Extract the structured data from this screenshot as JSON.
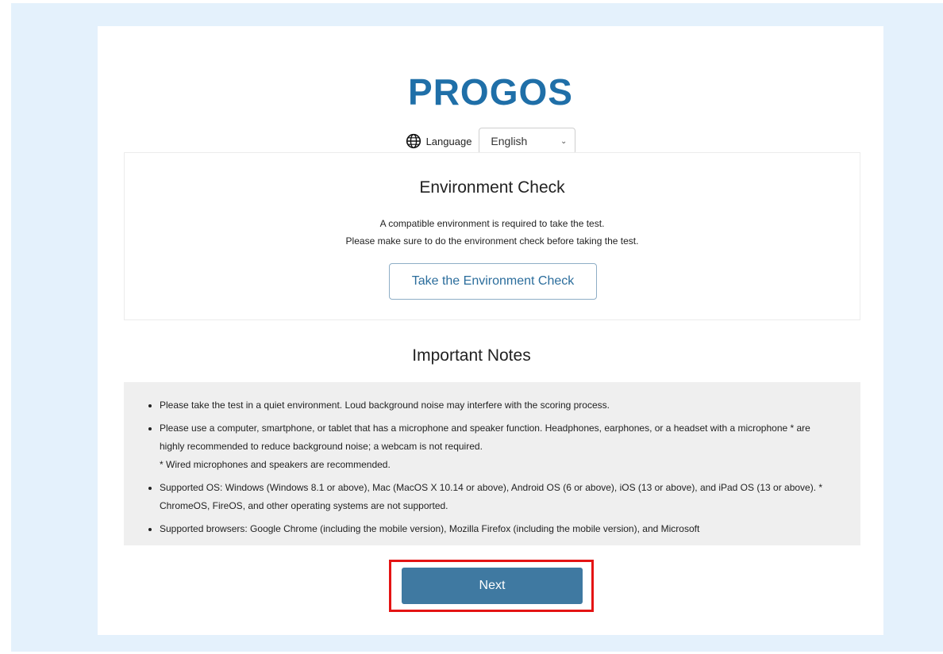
{
  "brand": {
    "logo": "PROGOS",
    "logo_color": "#1f6fa8"
  },
  "language": {
    "icon": "globe-icon",
    "label": "Language",
    "selected": "English"
  },
  "environment_check": {
    "title": "Environment Check",
    "description_line1": "A compatible environment is required to take the test.",
    "description_line2": "Please make sure to do the environment check before taking the test.",
    "button_label": "Take the Environment Check"
  },
  "important_notes": {
    "title": "Important Notes",
    "items": [
      {
        "text": "Please take the test in a quiet environment. Loud background noise may interfere with the scoring process."
      },
      {
        "text": "Please use a computer, smartphone, or tablet that has a microphone and speaker function. Headphones, earphones, or a headset with a microphone * are highly recommended to reduce background noise; a webcam is not required.",
        "note": "* Wired microphones and speakers are recommended."
      },
      {
        "text": "Supported OS: Windows (Windows 8.1 or above), Mac (MacOS X 10.14 or above), Android OS (6 or above), iOS (13 or above), and iPad OS (13 or above). * ChromeOS, FireOS, and other operating systems are not supported."
      },
      {
        "text": "Supported browsers: Google Chrome (including the mobile version), Mozilla Firefox (including the mobile version), and Microsoft"
      }
    ]
  },
  "next_button": {
    "label": "Next",
    "color": "#3f79a1",
    "highlight_color": "#e41414"
  },
  "colors": {
    "frame_background": "#e4f1fc",
    "notes_background": "#efefef"
  }
}
